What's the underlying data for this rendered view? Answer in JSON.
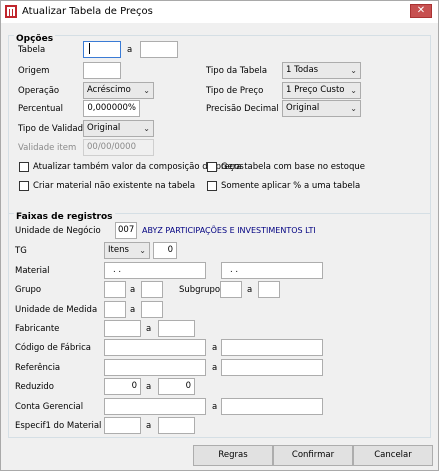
{
  "window": {
    "title": "Atualizar Tabela de Preços",
    "close_glyph": "✕",
    "icon": "app-logo-icon"
  },
  "opcoes": {
    "title": "Opções",
    "tabela_label": "Tabela",
    "tabela_from": "",
    "tabela_sep": "a",
    "tabela_to": "",
    "origem_label": "Origem",
    "origem_value": "",
    "operacao_label": "Operação",
    "operacao_value": "Acréscimo",
    "percentual_label": "Percentual",
    "percentual_value": "0,000000%",
    "tipo_validade_label": "Tipo de Validade",
    "tipo_validade_value": "Original",
    "validade_item_label": "Validade item",
    "validade_item_value": "00/00/0000",
    "tipo_tabela_label": "Tipo da Tabela",
    "tipo_tabela_value": "1 Todas",
    "tipo_preco_label": "Tipo de Preço",
    "tipo_preco_value": "1 Preço Custo",
    "precisao_label": "Precisão Decimal",
    "precisao_value": "Original",
    "chk_composicao": "Atualizar também valor da composição de preços",
    "chk_criar_material": "Criar material não existente na tabela",
    "chk_gera_tabela": "Gera tabela com base no estoque",
    "chk_somente_aplicar": "Somente aplicar % a uma tabela"
  },
  "faixas": {
    "title": "Faixas de registros",
    "unidade_negocio_label": "Unidade de Negócio",
    "unidade_negocio_code": "007",
    "unidade_negocio_name": "ABYZ PARTICIPAÇÕES E INVESTIMENTOS LTI",
    "tg_label": "TG",
    "tg_value": "Itens",
    "tg_number": "0",
    "material_label": "Material",
    "material_from": ". .",
    "material_to": ". .",
    "grupo_label": "Grupo",
    "subgrupo_label": "Subgrupo",
    "unidade_medida_label": "Unidade de Medida",
    "fabricante_label": "Fabricante",
    "codigo_fabrica_label": "Código de Fábrica",
    "referencia_label": "Referência",
    "reduzido_label": "Reduzido",
    "reduzido_from": "0",
    "reduzido_to": "0",
    "conta_gerencial_label": "Conta Gerencial",
    "especif_label": "Especif1 do Material",
    "sep": "a"
  },
  "buttons": {
    "regras": "Regras",
    "confirmar": "Confirmar",
    "cancelar": "Cancelar"
  }
}
